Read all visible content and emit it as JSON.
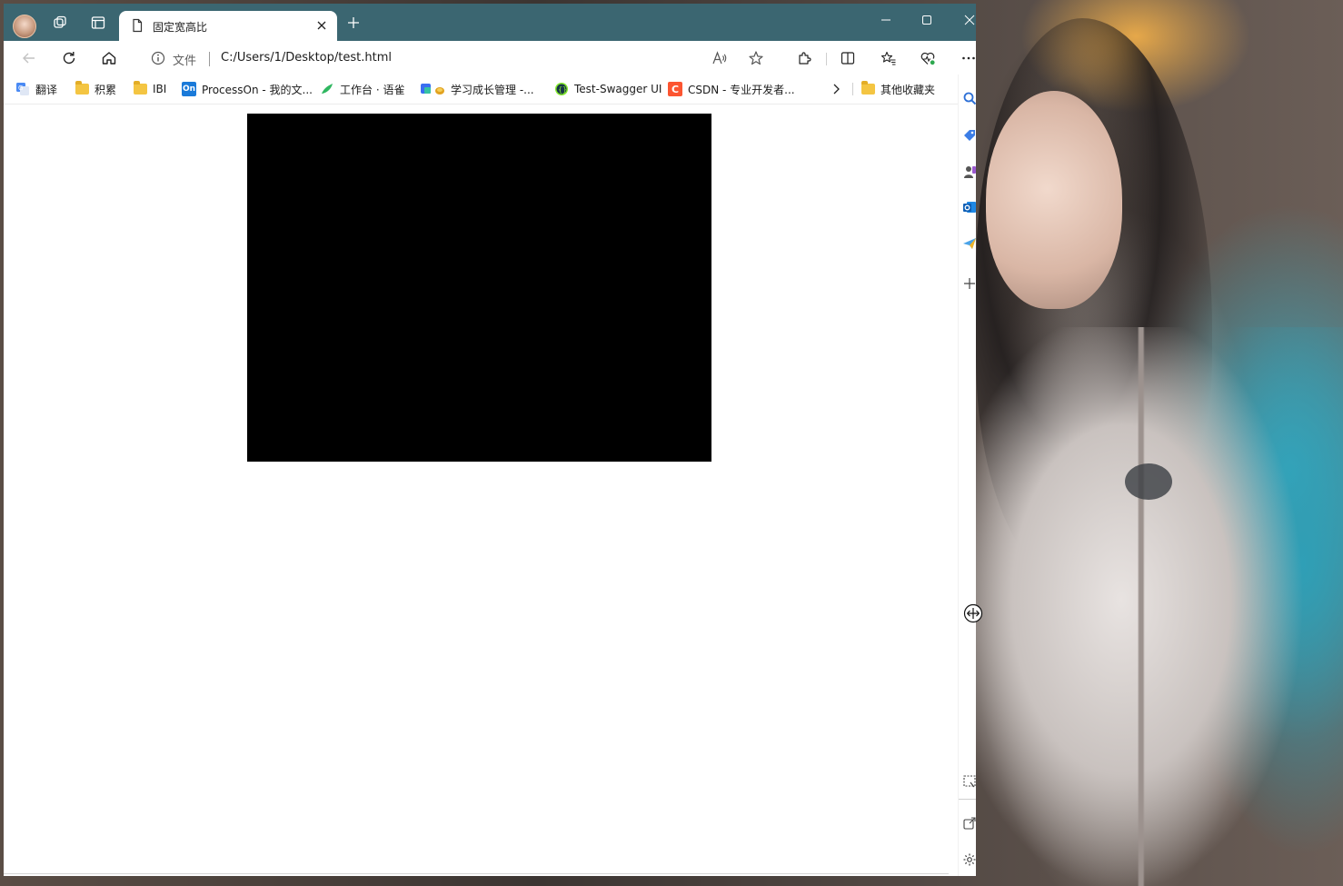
{
  "window": {
    "tab_title": "固定宽高比",
    "colors": {
      "titlebar": "#3b6671",
      "page_bg": "#ffffff",
      "canvas": "#000000"
    }
  },
  "toolbar": {
    "site_info_label": "文件",
    "url": "C:/Users/1/Desktop/test.html"
  },
  "bookmarks": [
    {
      "label": "翻译",
      "icon": "translate-icon"
    },
    {
      "label": "积累",
      "icon": "folder-icon"
    },
    {
      "label": "IBI",
      "icon": "folder-icon"
    },
    {
      "label": "ProcessOn - 我的文...",
      "icon": "processon-icon"
    },
    {
      "label": "工作台 · 语雀",
      "icon": "yuque-icon"
    },
    {
      "label": "学习成长管理 -...",
      "icon": "growth-icon"
    },
    {
      "label": "Test-Swagger UI",
      "icon": "swagger-icon"
    },
    {
      "label": "CSDN - 专业开发者...",
      "icon": "csdn-icon"
    },
    {
      "label": "其他收藏夹",
      "icon": "folder-icon"
    }
  ],
  "icons": {
    "processon_glyph": "On",
    "csdn_glyph": "C"
  }
}
